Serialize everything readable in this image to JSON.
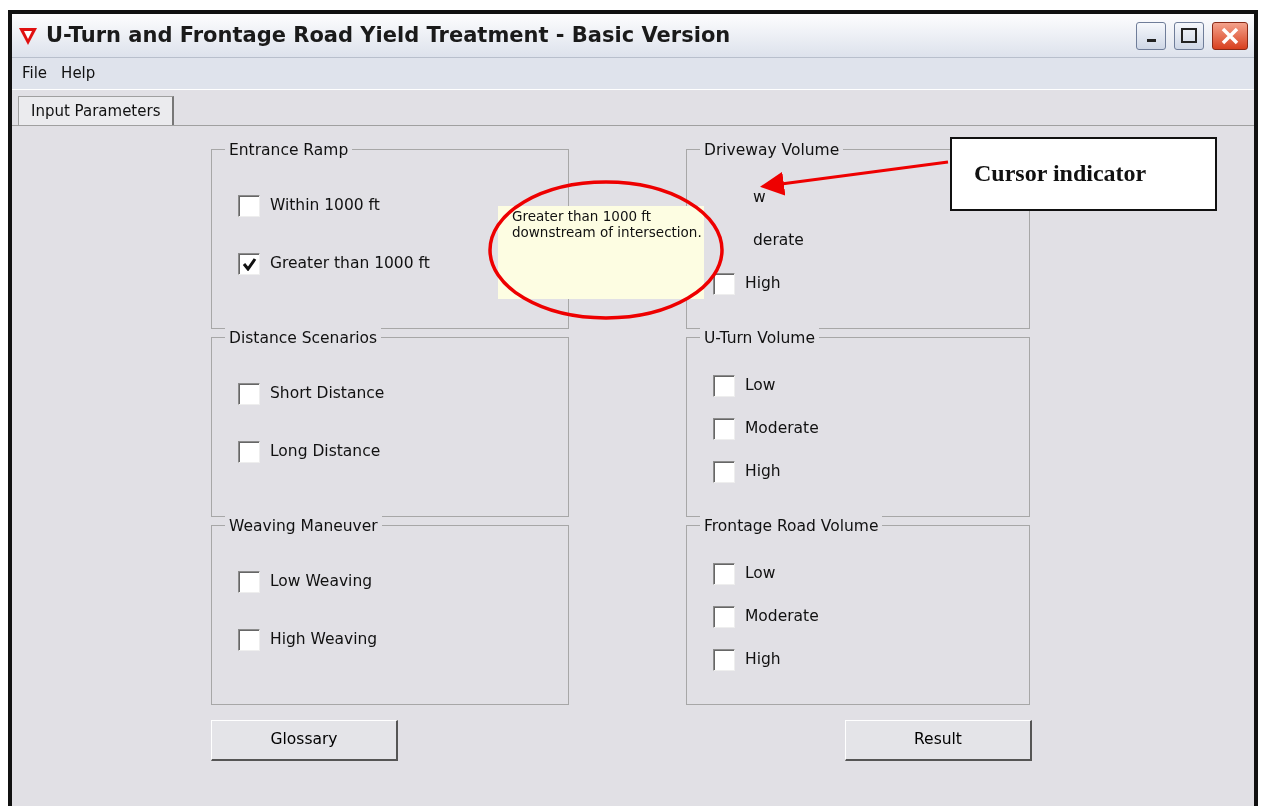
{
  "window": {
    "title": "U-Turn and Frontage Road Yield Treatment - Basic Version"
  },
  "menu": [
    "File",
    "Help"
  ],
  "tabs": [
    {
      "label": "Input Parameters",
      "selected": true
    }
  ],
  "groups": [
    {
      "title": "Entrance Ramp",
      "options": [
        {
          "kind": "checkbox",
          "label": "Within 1000 ft",
          "checked": false
        },
        {
          "kind": "checkbox",
          "label": "Greater than 1000 ft",
          "checked": true
        }
      ]
    },
    {
      "title": "Driveway Volume",
      "options": [
        {
          "kind": "covered",
          "label": "w"
        },
        {
          "kind": "covered",
          "label": "derate"
        },
        {
          "kind": "checkbox",
          "label": "High",
          "checked": false
        }
      ]
    },
    {
      "title": "Distance Scenarios",
      "options": [
        {
          "kind": "checkbox",
          "label": "Short Distance",
          "checked": false
        },
        {
          "kind": "checkbox",
          "label": "Long Distance",
          "checked": false
        }
      ]
    },
    {
      "title": "U-Turn Volume",
      "options": [
        {
          "kind": "checkbox",
          "label": "Low",
          "checked": false
        },
        {
          "kind": "checkbox",
          "label": "Moderate",
          "checked": false
        },
        {
          "kind": "checkbox",
          "label": "High",
          "checked": false
        }
      ]
    },
    {
      "title": "Weaving Maneuver",
      "options": [
        {
          "kind": "checkbox",
          "label": "Low Weaving",
          "checked": false
        },
        {
          "kind": "checkbox",
          "label": "High Weaving",
          "checked": false
        }
      ]
    },
    {
      "title": "Frontage Road Volume",
      "options": [
        {
          "kind": "checkbox",
          "label": "Low",
          "checked": false
        },
        {
          "kind": "checkbox",
          "label": "Moderate",
          "checked": false
        },
        {
          "kind": "checkbox",
          "label": "High",
          "checked": false
        }
      ]
    }
  ],
  "buttons": [
    "Glossary",
    "Result"
  ],
  "tooltip": {
    "lines": [
      "Greater than 1000 ft",
      "downstream of intersection."
    ]
  },
  "annotation": {
    "label": "Cursor indicator"
  }
}
